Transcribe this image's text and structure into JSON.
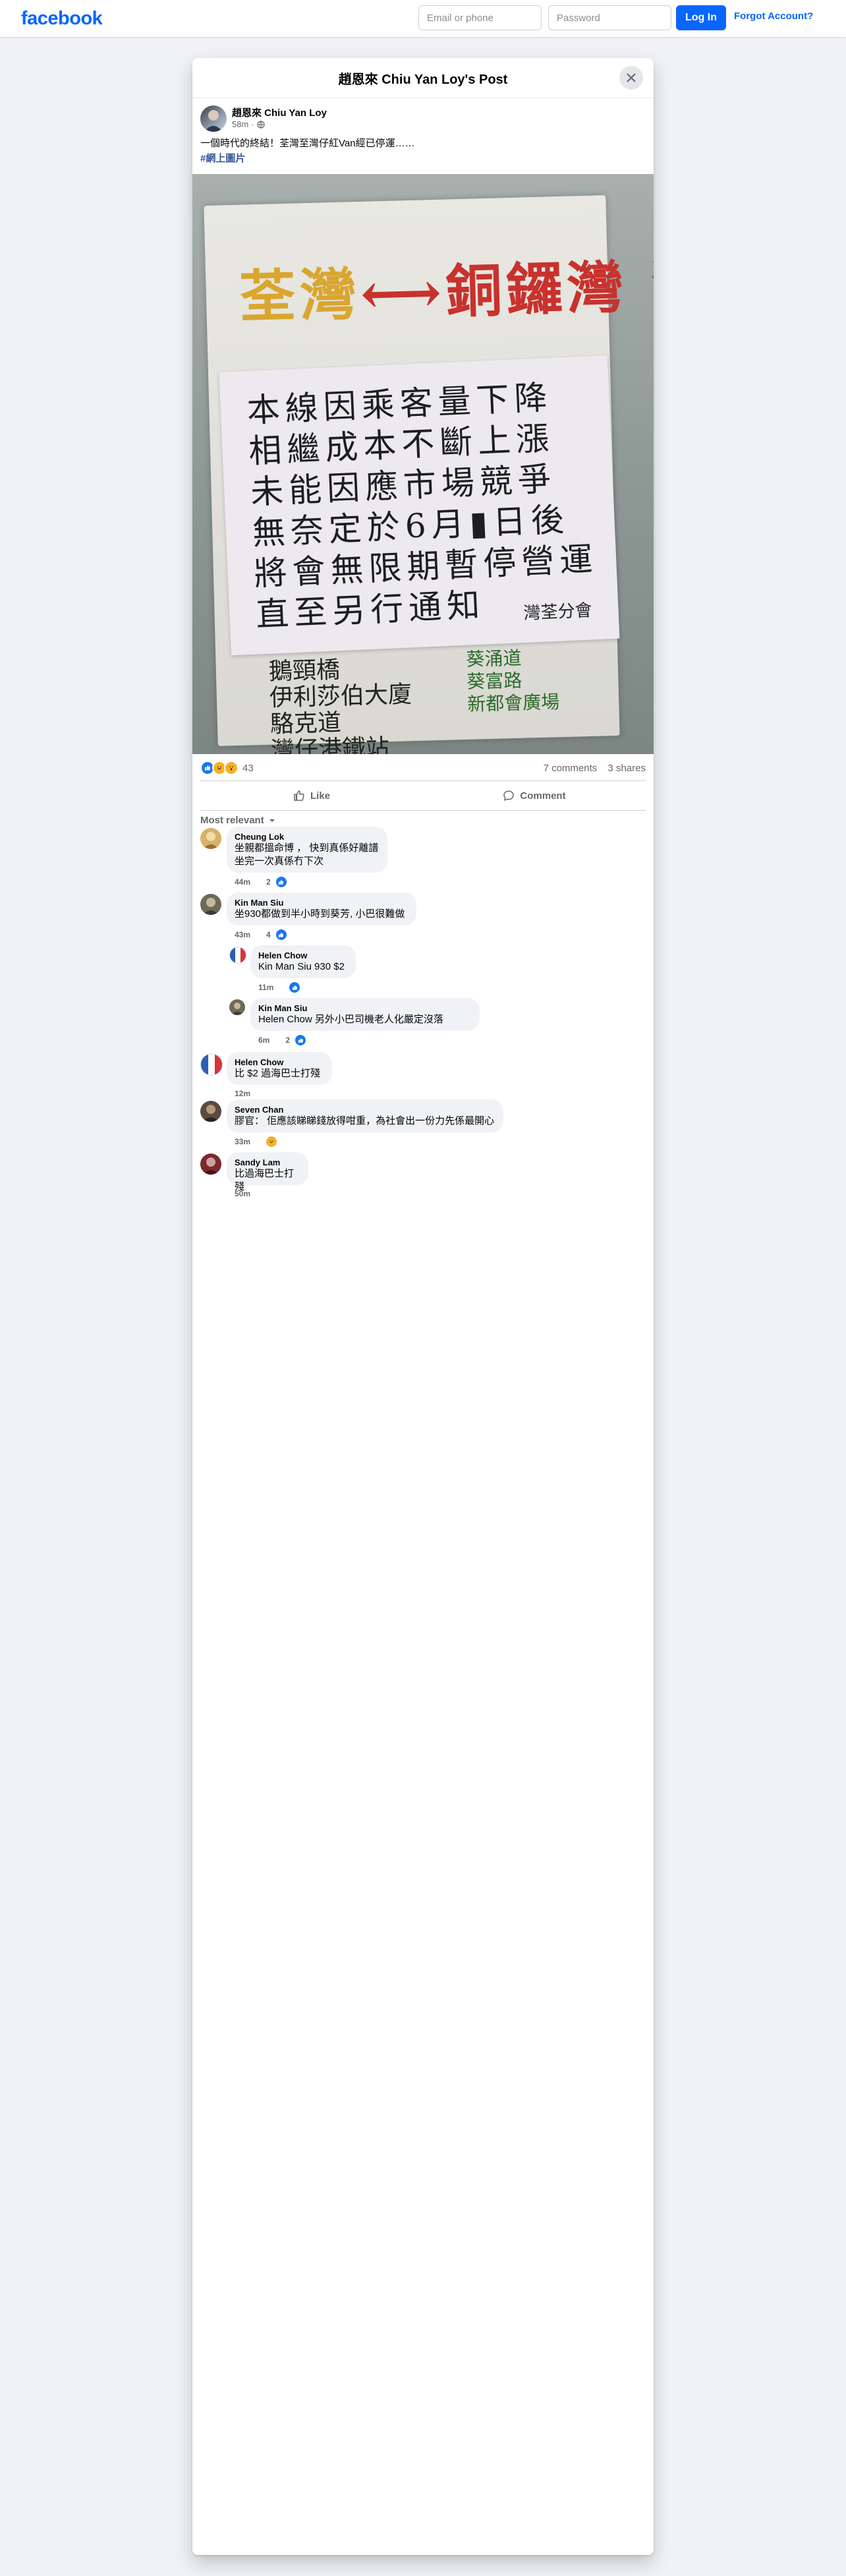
{
  "brand": {
    "logo": "facebook",
    "color": "#0866ff"
  },
  "login": {
    "email_placeholder": "Email or phone",
    "password_placeholder": "Password",
    "login_label": "Log In",
    "forgot_label": "Forgot Account?"
  },
  "post": {
    "header_title": "趙恩來 Chiu Yan Loy's Post",
    "author": "趙恩來 Chiu Yan Loy",
    "time": "58m",
    "privacy_icon": "globe-icon",
    "text": "一個時代的終結！荃灣至灣仔紅Van經已停運……",
    "hashtag": "#網上圖片",
    "photo": {
      "route": [
        "荃灣",
        "⟷",
        "銅鑼灣",
        "灣仔"
      ],
      "notice_lines": [
        "本線因乘客量下降",
        "相繼成本不斷上漲",
        "未能因應市場競爭",
        "無奈定於6月▮日後",
        "將會無限期暫停營運",
        "直至另行通知"
      ],
      "notice_sign": "灣荃分會",
      "stops": [
        "鵝頸橋",
        "伊利莎伯大廈",
        "駱克道",
        "灣仔港鐵站"
      ],
      "stops_right": [
        "葵涌道",
        "葵富路",
        "新都會廣場"
      ]
    },
    "reactions": {
      "icons": [
        "like-icon",
        "haha-icon",
        "wow-icon"
      ],
      "count": "43"
    },
    "comments_count": "7 comments",
    "shares_count": "3 shares",
    "actions": {
      "like": "Like",
      "comment": "Comment"
    },
    "sort_label": "Most relevant"
  },
  "comments": [
    {
      "name": "Cheung Lok",
      "lines": [
        "坐親都搵命博 ， 快到真係好離譜",
        "坐完一次真係冇下次"
      ],
      "time": "44m",
      "likes": "2",
      "color": "#d8b16a"
    },
    {
      "name": "Kin Man Siu",
      "lines": [
        "坐930都做到半小時到葵芳, 小巴很難做"
      ],
      "time": "43m",
      "likes": "4",
      "color": "#6e6a5a"
    },
    {
      "name": "Helen Chow",
      "lines": [
        "Kin Man Siu 930 $2"
      ],
      "time": "11m",
      "likes": "",
      "color": "#2b5fb8"
    },
    {
      "name": "Kin Man Siu",
      "lines": [
        "Helen Chow 另外小巴司機老人化嚴定沒落"
      ],
      "time": "6m",
      "likes": "2",
      "color": "#6e6a5a"
    },
    {
      "name": "Helen Chow",
      "lines": [
        "比 $2 過海巴士打殘"
      ],
      "time": "12m",
      "likes": "",
      "color": "#2b5fb8"
    },
    {
      "name": "Seven Chan",
      "lines": [
        "膠官： 佢應該睇睇錢放得咁重，為社會出一份力先係最開心"
      ],
      "time": "33m",
      "likes": "",
      "color": "#5a4a40"
    },
    {
      "name": "Sandy Lam",
      "lines": [
        "比過海巴士打殘"
      ],
      "time": "50m",
      "likes": "",
      "color": "#7a2a30"
    }
  ]
}
